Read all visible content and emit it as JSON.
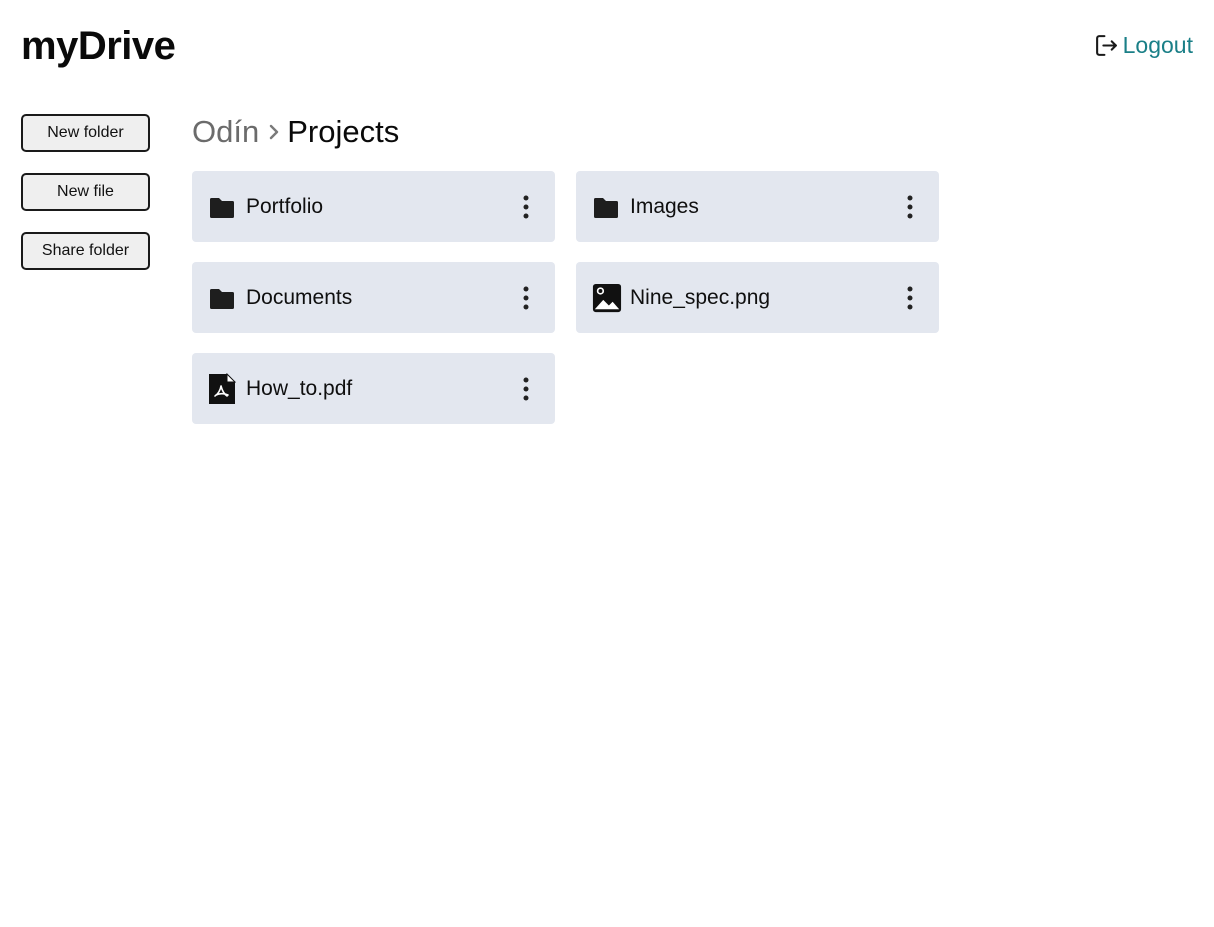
{
  "header": {
    "title": "myDrive",
    "logout_label": "Logout",
    "logout_icon": "logout-icon",
    "link_color": "#1a7f87"
  },
  "sidebar": {
    "buttons": [
      {
        "label": "New folder"
      },
      {
        "label": "New file"
      },
      {
        "label": "Share folder"
      }
    ]
  },
  "breadcrumb": {
    "parent": "Odín",
    "separator_icon": "chevron-right-icon",
    "current": "Projects"
  },
  "items": [
    {
      "name": "Portfolio",
      "type": "folder",
      "icon": "folder-icon"
    },
    {
      "name": "Images",
      "type": "folder",
      "icon": "folder-icon"
    },
    {
      "name": "Documents",
      "type": "folder",
      "icon": "folder-icon"
    },
    {
      "name": "Nine_spec.png",
      "type": "image",
      "icon": "image-file-icon"
    },
    {
      "name": "How_to.pdf",
      "type": "pdf",
      "icon": "pdf-file-icon"
    }
  ],
  "colors": {
    "card_background": "#e3e7ef",
    "button_background": "#efefef"
  }
}
